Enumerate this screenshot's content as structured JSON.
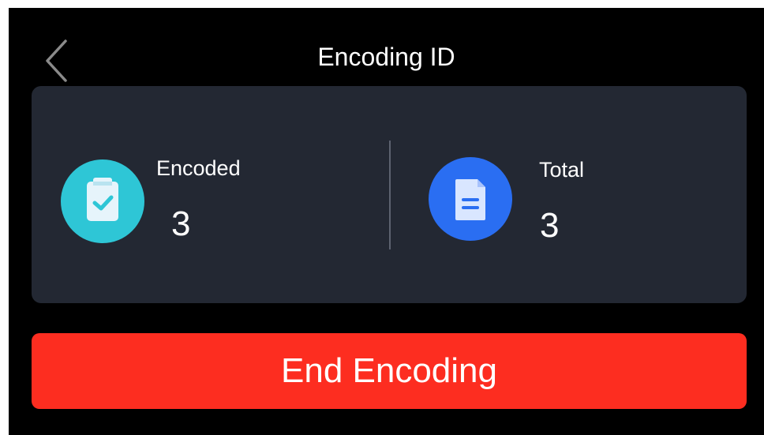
{
  "header": {
    "title": "Encoding ID",
    "back_icon": "chevron-left-icon"
  },
  "stats": {
    "encoded": {
      "label": "Encoded",
      "value": "3",
      "icon": "clipboard-check-icon",
      "color": "#2ec6d6"
    },
    "total": {
      "label": "Total",
      "value": "3",
      "icon": "document-icon",
      "color": "#2a6ef2"
    }
  },
  "actions": {
    "end_label": "End Encoding",
    "end_color": "#fd2d20"
  }
}
